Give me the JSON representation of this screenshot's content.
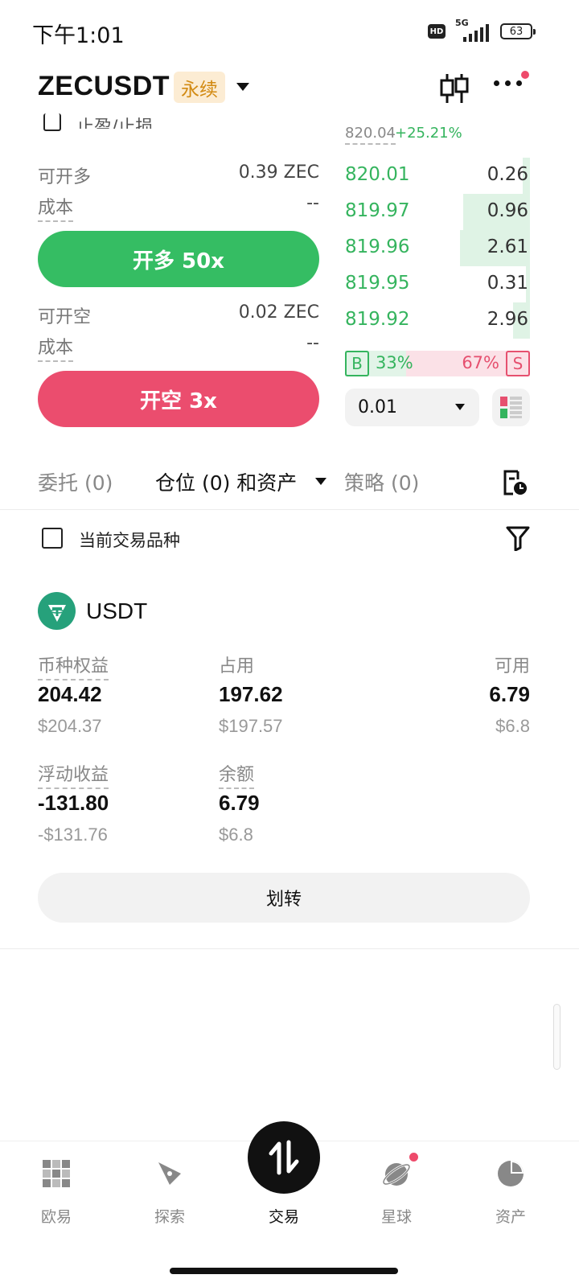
{
  "status_bar": {
    "time": "下午1:01",
    "hd": "HD",
    "network": "5G",
    "battery": "63"
  },
  "header": {
    "pair": "ZECUSDT",
    "contract_type": "永续"
  },
  "trade_panel": {
    "partial_label": "止盈/止损",
    "long": {
      "available_label": "可开多",
      "available_value": "0.39 ZEC",
      "cost_label": "成本",
      "cost_value": "--",
      "button": "开多 50x"
    },
    "short": {
      "available_label": "可开空",
      "available_value": "0.02 ZEC",
      "cost_label": "成本",
      "cost_value": "--",
      "button": "开空 3x"
    }
  },
  "order_book": {
    "top_price": "820.04",
    "change": "+25.21%",
    "bids": [
      {
        "price": "820.01",
        "qty": "0.26",
        "depth": 0.04
      },
      {
        "price": "819.97",
        "qty": "0.96",
        "depth": 0.36
      },
      {
        "price": "819.96",
        "qty": "2.61",
        "depth": 0.38
      },
      {
        "price": "819.95",
        "qty": "0.31",
        "depth": 0.02
      },
      {
        "price": "819.92",
        "qty": "2.96",
        "depth": 0.09
      }
    ],
    "buy_label": "B",
    "buy_pct": "33%",
    "sell_pct": "67%",
    "sell_label": "S",
    "buy_ratio": 0.33,
    "precision": "0.01"
  },
  "tabs": [
    {
      "label": "委托 (0)"
    },
    {
      "label": "仓位 (0) 和资产"
    },
    {
      "label": "策略 (0)"
    }
  ],
  "filter": {
    "current_only_label": "当前交易品种"
  },
  "asset": {
    "coin": "USDT",
    "equity_label": "币种权益",
    "equity_value": "204.42",
    "equity_usd": "$204.37",
    "used_label": "占用",
    "used_value": "197.62",
    "used_usd": "$197.57",
    "available_label": "可用",
    "available_value": "6.79",
    "available_usd": "$6.8",
    "upl_label": "浮动收益",
    "upl_value": "-131.80",
    "upl_usd": "-$131.76",
    "balance_label": "余额",
    "balance_value": "6.79",
    "balance_usd": "$6.8",
    "transfer_button": "划转"
  },
  "bottom_nav": [
    {
      "label": "欧易",
      "icon": "okx-logo-icon"
    },
    {
      "label": "探索",
      "icon": "compass-icon"
    },
    {
      "label": "交易",
      "icon": "swap-arrows-icon"
    },
    {
      "label": "星球",
      "icon": "planet-icon"
    },
    {
      "label": "资产",
      "icon": "pie-chart-icon"
    }
  ],
  "colors": {
    "buy": "#35bd63",
    "sell": "#eb4d6e",
    "badge_bg": "#fcecd3",
    "badge_text": "#d28a12"
  }
}
